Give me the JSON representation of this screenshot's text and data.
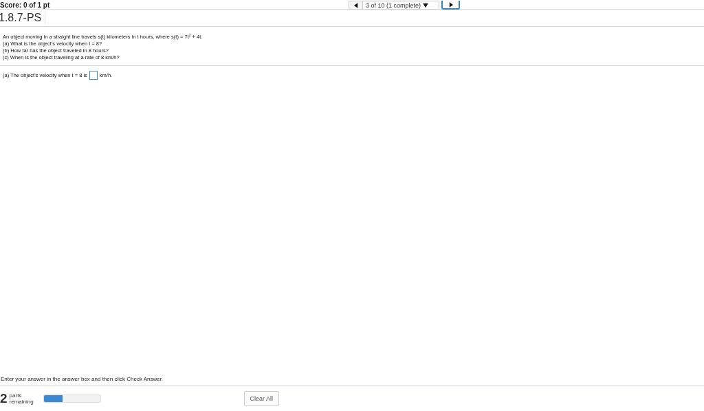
{
  "header": {
    "score": "Score: 0 of 1 pt",
    "navigator": "3 of 10 (1 complete)"
  },
  "title": "1.8.7-PS",
  "question": {
    "lines": [
      "An object moving in a straight line travels s(t) kilometers in t hours, where s(t) = 7t$^{2}$ + 4t.",
      "(a) What is the object's velocity when t = 8?",
      "(b) How far has the object traveled in 8 hours?",
      "(c) When is the object traveling at a rate of 8 km/h?"
    ]
  },
  "answer": {
    "before": "(a) The object's velocity when t = 8 is",
    "after": "km/h."
  },
  "instruction": "Enter your answer in the answer box and then click Check Answer.",
  "footer": {
    "count": "2",
    "label": "parts remaining",
    "level": 0.33,
    "button": "Clear All"
  }
}
